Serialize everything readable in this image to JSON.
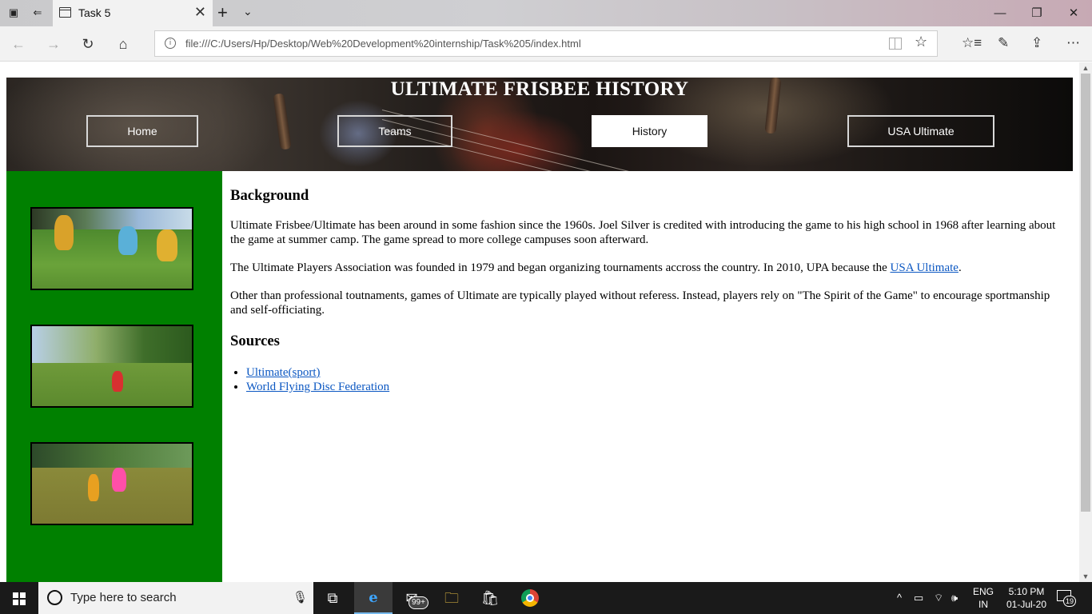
{
  "browser": {
    "tab_title": "Task 5",
    "tab_close": "✕",
    "new_tab": "+",
    "address_url": "file:///C:/Users/Hp/Desktop/Web%20Development%20internship/Task%205/index.html",
    "window_minimize": "—",
    "window_restore": "❐",
    "window_close": "✕",
    "icons": [
      "tab-preview-icon",
      "set-aside-tabs-icon",
      "page-icon",
      "back-icon",
      "forward-icon",
      "refresh-icon",
      "home-icon",
      "site-info-icon",
      "reading-view-icon",
      "favorite-star-icon",
      "favorites-hub-icon",
      "add-notes-icon",
      "share-icon",
      "more-icon"
    ]
  },
  "page": {
    "site_title": "ULTIMATE FRISBEE HISTORY",
    "nav": [
      {
        "label": "Home"
      },
      {
        "label": "Teams"
      },
      {
        "label": "History"
      },
      {
        "label": "USA Ultimate"
      }
    ],
    "active_nav": "History",
    "colors": {
      "sidebar": "#008000",
      "link": "#0b57c2",
      "active_nav_bg": "#ffffff"
    },
    "background_heading": "Background",
    "para1": "Ultimate Frisbee/Ultimate has been around in some fashion since the 1960s. Joel Silver is credited with introducing the game to his high school in 1968 after learning about the game at summer camp. The game spread to more college campuses soon afterward.",
    "para2_before": "The Ultimate Players Association was founded in 1979 and began organizing tournaments accross the country. In 2010, UPA because the ",
    "para2_link": "USA Ultimate",
    "para2_after": ".",
    "para3": "Other than professional toutnaments, games of Ultimate are typically played without referess. Instead, players rely on \"The Spirit of the Game\" to encourage sportmanship and self-officiating.",
    "sources_heading": "Sources",
    "sources": [
      {
        "label": "Ultimate(sport)"
      },
      {
        "label": "World Flying Disc Federation"
      }
    ]
  },
  "taskbar": {
    "search_placeholder": "Type here to search",
    "mail_badge": "99+",
    "lang_line1": "ENG",
    "lang_line2": "IN",
    "time": "5:10 PM",
    "date": "01-Jul-20",
    "notification_count": "19"
  }
}
